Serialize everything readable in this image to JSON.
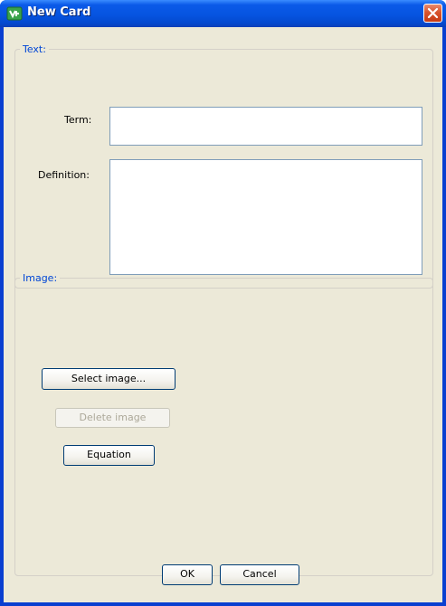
{
  "window": {
    "title": "New Card"
  },
  "text_group": {
    "legend": "Text:",
    "term_label": "Term:",
    "term_value": "",
    "definition_label": "Definition:",
    "definition_value": ""
  },
  "image_group": {
    "legend": "Image:",
    "select_image_label": "Select image...",
    "delete_image_label": "Delete image",
    "equation_label": "Equation"
  },
  "footer": {
    "ok_label": "OK",
    "cancel_label": "Cancel"
  },
  "colors": {
    "titlebar": "#0654e0",
    "dialog_background": "#ece9d8",
    "legend_text": "#0046d5",
    "close_button": "#d8542e"
  },
  "icons": {
    "app_icon": "green-card-app-icon",
    "close_icon": "close-icon"
  }
}
